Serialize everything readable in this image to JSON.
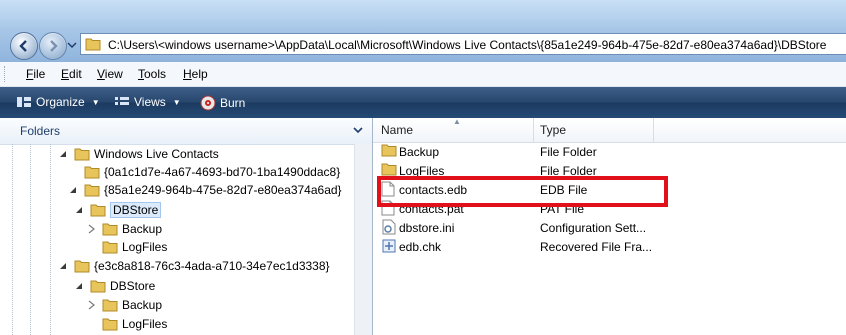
{
  "address": {
    "path": "C:\\Users\\<windows username>\\AppData\\Local\\Microsoft\\Windows Live Contacts\\{85a1e249-964b-475e-82d7-e80ea374a6ad}\\DBStore"
  },
  "menu": [
    {
      "label": "File",
      "key": "F",
      "rest": "ile"
    },
    {
      "label": "Edit",
      "key": "E",
      "rest": "dit"
    },
    {
      "label": "View",
      "key": "V",
      "rest": "iew"
    },
    {
      "label": "Tools",
      "key": "T",
      "rest": "ools"
    },
    {
      "label": "Help",
      "key": "H",
      "rest": "elp"
    }
  ],
  "toolbar": {
    "organize_label": "Organize",
    "views_label": "Views",
    "burn_label": "Burn"
  },
  "left_pane": {
    "title": "Folders",
    "tree": [
      {
        "label": "Windows Live Contacts"
      },
      {
        "label": "{0a1c1d7e-4a67-4693-bd70-1ba1490ddac8}"
      },
      {
        "label": "{85a1e249-964b-475e-82d7-e80ea374a6ad}"
      },
      {
        "label": "DBStore"
      },
      {
        "label": "Backup"
      },
      {
        "label": "LogFiles"
      },
      {
        "label": "{e3c8a818-76c3-4ada-a710-34e7ec1d3338}"
      },
      {
        "label": "DBStore"
      },
      {
        "label": "Backup"
      },
      {
        "label": "LogFiles"
      }
    ]
  },
  "right_pane": {
    "columns": [
      "Name",
      "Type"
    ],
    "files": [
      {
        "name": "Backup",
        "type": "File Folder"
      },
      {
        "name": "LogFiles",
        "type": "File Folder"
      },
      {
        "name": "contacts.edb",
        "type": "EDB File"
      },
      {
        "name": "contacts.pat",
        "type": "PAT File"
      },
      {
        "name": "dbstore.ini",
        "type": "Configuration Sett..."
      },
      {
        "name": "edb.chk",
        "type": "Recovered File Fra..."
      }
    ]
  },
  "colors": {
    "highlight": "#e1101b",
    "toolbar": "#27466e",
    "selection": "#dcebfb"
  }
}
